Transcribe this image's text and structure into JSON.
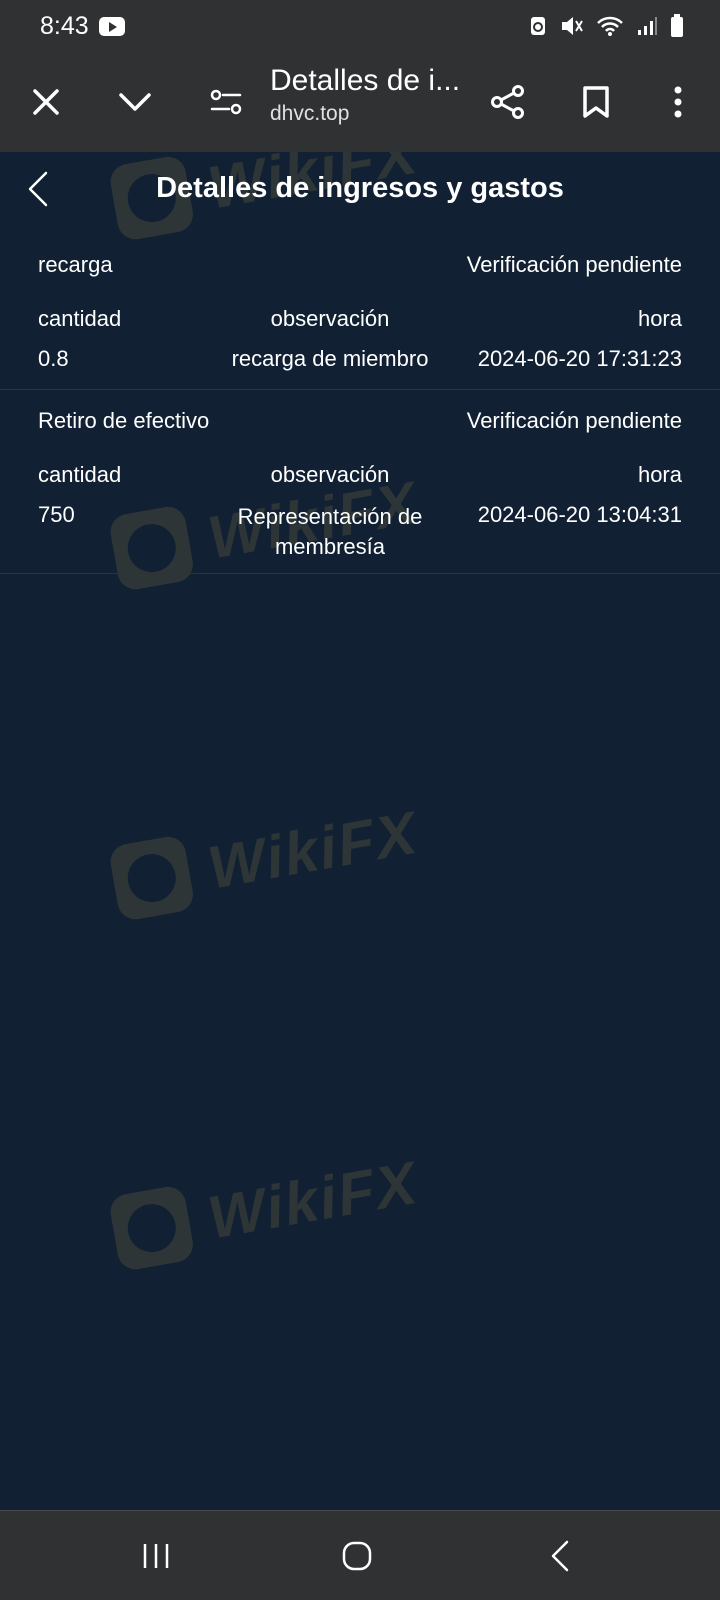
{
  "status_bar": {
    "time": "8:43",
    "icons": [
      "youtube-icon",
      "recycle-icon",
      "mute-icon",
      "wifi-icon",
      "signal-icon",
      "battery-icon"
    ]
  },
  "browser": {
    "page_title": "Detalles de i...",
    "host": "dhvc.top",
    "icons": [
      "close-icon",
      "chevron-down-icon",
      "page-settings-icon",
      "share-icon",
      "bookmark-icon",
      "more-vertical-icon"
    ]
  },
  "page": {
    "title": "Detalles de ingresos y gastos"
  },
  "records": [
    {
      "type": "recarga",
      "status": "Verificación pendiente",
      "labels": {
        "amount": "cantidad",
        "note": "observación",
        "time": "hora"
      },
      "amount": "0.8",
      "note": "recarga de miembro",
      "time": "2024-06-20 17:31:23"
    },
    {
      "type": "Retiro de efectivo",
      "status": "Verificación pendiente",
      "labels": {
        "amount": "cantidad",
        "note": "observación",
        "time": "hora"
      },
      "amount": "750",
      "note": "Representación de membresía",
      "time": "2024-06-20 13:04:31"
    }
  ],
  "watermark": {
    "text": "WikiFX"
  },
  "colors": {
    "background": "#112033",
    "bar": "#303133",
    "text": "#ffffff",
    "watermark": "#d8b24a"
  }
}
